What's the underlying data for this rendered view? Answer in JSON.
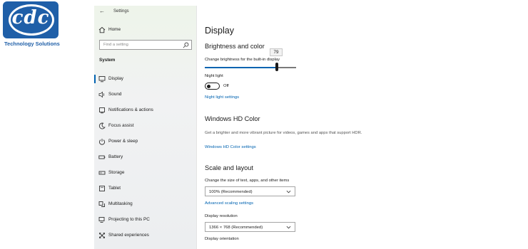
{
  "logo": {
    "text": "cdc",
    "caption": "Technology Solutions",
    "brand_color": "#1f5fa8"
  },
  "window": {
    "title": "Settings",
    "back_icon": "back-arrow-icon"
  },
  "sidebar": {
    "home_label": "Home",
    "search_placeholder": "Find a setting",
    "section_label": "System",
    "items": [
      {
        "label": "Display",
        "icon": "monitor-icon",
        "active": true
      },
      {
        "label": "Sound",
        "icon": "speaker-icon"
      },
      {
        "label": "Notifications & actions",
        "icon": "notification-icon"
      },
      {
        "label": "Focus assist",
        "icon": "moon-icon"
      },
      {
        "label": "Power & sleep",
        "icon": "power-icon"
      },
      {
        "label": "Battery",
        "icon": "battery-icon"
      },
      {
        "label": "Storage",
        "icon": "storage-icon"
      },
      {
        "label": "Tablet",
        "icon": "tablet-icon"
      },
      {
        "label": "Multitasking",
        "icon": "multitasking-icon"
      },
      {
        "label": "Projecting to this PC",
        "icon": "projecting-icon"
      },
      {
        "label": "Shared experiences",
        "icon": "shared-experiences-icon"
      }
    ]
  },
  "main": {
    "title": "Display",
    "brightness": {
      "heading": "Brightness and color",
      "slider_label": "Change brightness for the built-in display",
      "value": "79",
      "accent": "#0063b1"
    },
    "night_light": {
      "label": "Night light",
      "toggle_state": "Off",
      "settings_link": "Night light settings"
    },
    "hd_color": {
      "heading": "Windows HD Color",
      "description": "Get a brighter and more vibrant picture for videos, games and apps that support HDR.",
      "settings_link": "Windows HD Color settings"
    },
    "scale_layout": {
      "heading": "Scale and layout",
      "scale_label": "Change the size of text, apps, and other items",
      "scale_value": "100% (Recommended)",
      "advanced_link": "Advanced scaling settings",
      "resolution_label": "Display resolution",
      "resolution_value": "1366 × 768 (Recommended)",
      "orientation_label": "Display orientation"
    }
  }
}
